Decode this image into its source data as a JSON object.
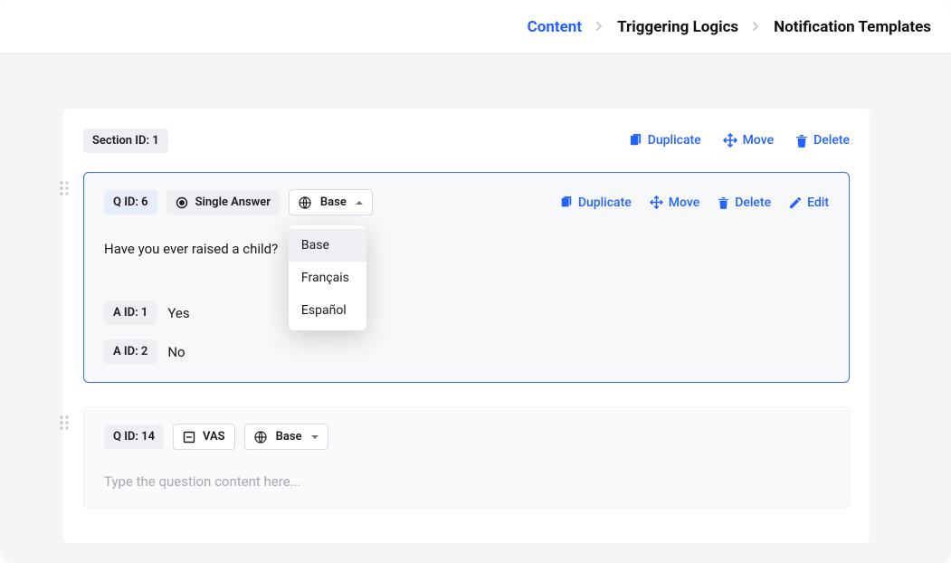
{
  "colors": {
    "accent": "#2463ff"
  },
  "icons": {
    "duplicate": "duplicate-icon",
    "move": "move-icon",
    "delete": "delete-icon",
    "edit": "edit-icon",
    "globe": "globe-icon",
    "single": "radio-dot-icon",
    "vas": "vas-icon",
    "drag": "drag-handle-icon"
  },
  "tabs": {
    "content": "Content",
    "triggering": "Triggering Logics",
    "templates": "Notification Templates",
    "active": "content"
  },
  "section": {
    "id_label": "Section ID: 1",
    "actions": {
      "duplicate": "Duplicate",
      "move": "Move",
      "delete": "Delete"
    }
  },
  "q1": {
    "id_label": "Q ID: 6",
    "type_label": "Single Answer",
    "lang_selected": "Base",
    "lang_options": [
      "Base",
      "Français",
      "Español"
    ],
    "actions": {
      "duplicate": "Duplicate",
      "move": "Move",
      "delete": "Delete",
      "edit": "Edit"
    },
    "text": "Have you ever raised a child?",
    "answers": [
      {
        "id_label": "A ID: 1",
        "text": "Yes"
      },
      {
        "id_label": "A ID: 2",
        "text": "No"
      }
    ]
  },
  "q2": {
    "id_label": "Q ID: 14",
    "type_label": "VAS",
    "lang_selected": "Base",
    "placeholder": "Type the question content here..."
  }
}
